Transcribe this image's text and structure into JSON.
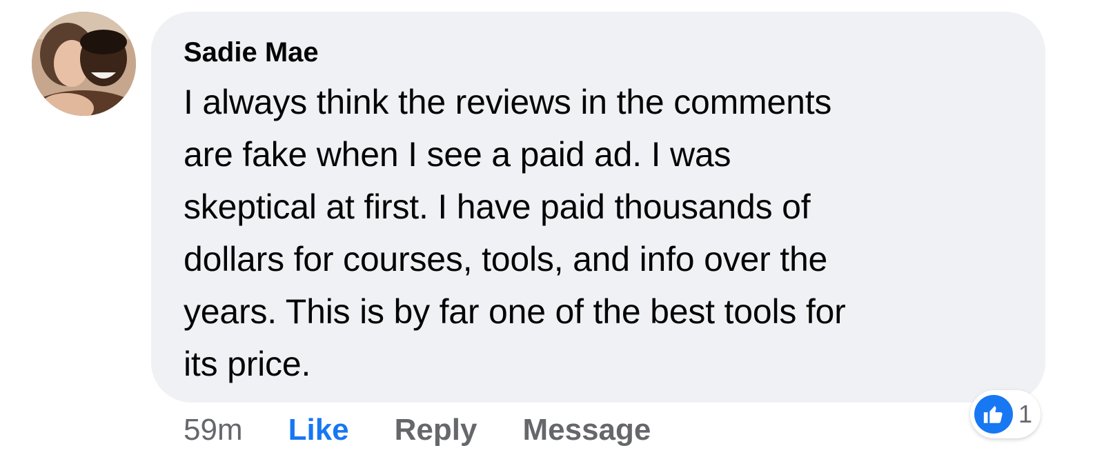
{
  "comment": {
    "author": "Sadie Mae",
    "text_lines": [
      "I always think the reviews in the comments",
      "are fake when I see a paid ad. I was",
      "skeptical at first. I have paid thousands of",
      "dollars for courses, tools, and info over the",
      "years. This is by far one of the best tools for",
      "its price."
    ]
  },
  "actions": {
    "timestamp": "59m",
    "like_label": "Like",
    "reply_label": "Reply",
    "message_label": "Message"
  },
  "reactions": {
    "icon": "thumbs-up-icon",
    "count": "1"
  },
  "colors": {
    "bubble_bg": "#f0f1f5",
    "text": "#050505",
    "secondary_text": "#65676b",
    "like_blue": "#1877f2"
  }
}
